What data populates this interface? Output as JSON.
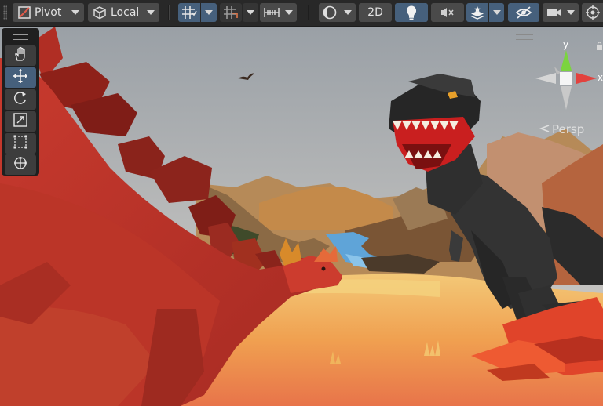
{
  "toolbar": {
    "pivot_label": "Pivot",
    "local_label": "Local",
    "mode_2d_label": "2D"
  },
  "tools": {
    "items": [
      "hand-tool",
      "move-tool",
      "rotate-tool",
      "scale-tool",
      "rect-tool",
      "transform-tool"
    ],
    "active": "move-tool"
  },
  "gizmo": {
    "y_label": "y",
    "x_label": "x",
    "projection_label": "Persp"
  },
  "colors": {
    "toolbar_bg": "#282828",
    "button_bg": "#4a4a4a",
    "active_blue": "#46607c",
    "gizmo_y": "#7bd43f",
    "gizmo_x": "#e2423e"
  }
}
